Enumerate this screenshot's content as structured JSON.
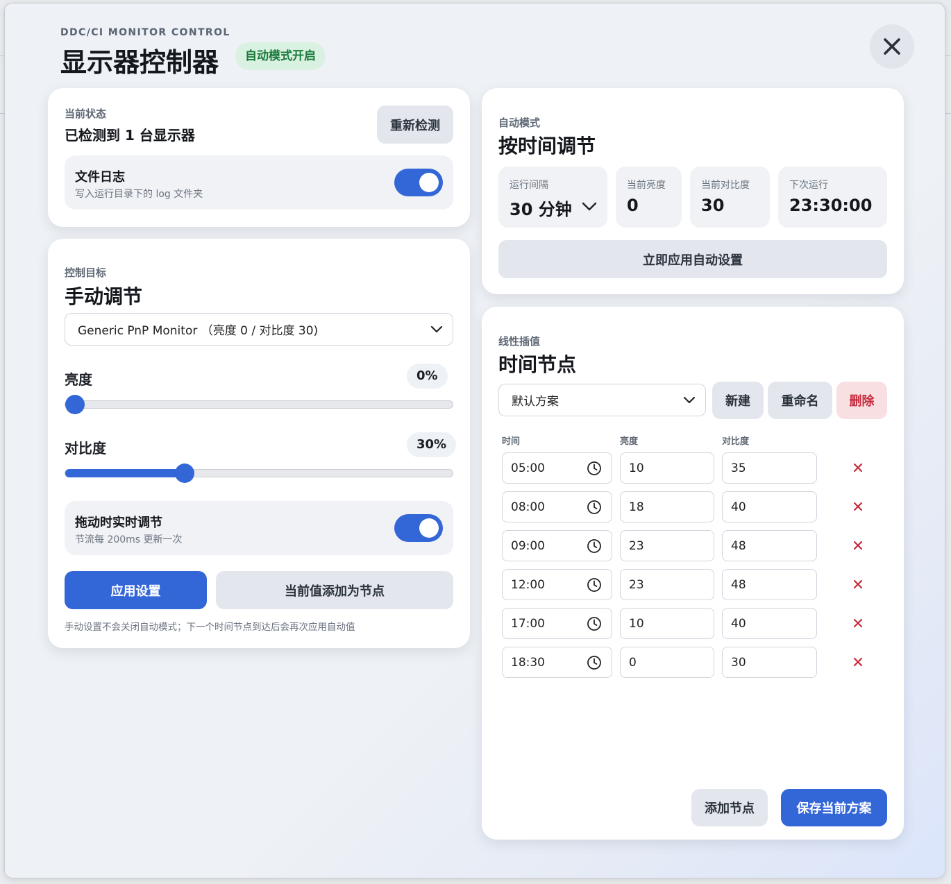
{
  "header": {
    "eyebrow": "DDC/CI MONITOR CONTROL",
    "title": "显示器控制器",
    "auto_badge": "自动模式开启"
  },
  "status": {
    "label": "当前状态",
    "title": "已检测到 1 台显示器",
    "redetect_button": "重新检测",
    "file_log": {
      "title": "文件日志",
      "subtitle": "写入运行目录下的 log 文件夹",
      "enabled": true
    }
  },
  "manual": {
    "label": "控制目标",
    "title": "手动调节",
    "monitor_select": "Generic PnP Monitor （亮度 0 / 对比度 30)",
    "brightness": {
      "label": "亮度",
      "value_text": "0%",
      "value": 0
    },
    "contrast": {
      "label": "对比度",
      "value_text": "30%",
      "value": 30
    },
    "realtime": {
      "title": "拖动时实时调节",
      "subtitle": "节流每 200ms 更新一次",
      "enabled": true
    },
    "apply_button": "应用设置",
    "add_node_button": "当前值添加为节点",
    "note": "手动设置不会关闭自动模式；下一个时间节点到达后会再次应用自动值"
  },
  "auto": {
    "label": "自动模式",
    "title": "按时间调节",
    "stats": [
      {
        "label": "运行间隔",
        "value": "30 分钟"
      },
      {
        "label": "当前亮度",
        "value": "0"
      },
      {
        "label": "当前对比度",
        "value": "30"
      },
      {
        "label": "下次运行",
        "value": "23:30:00"
      }
    ],
    "apply_now_button": "立即应用自动设置"
  },
  "nodes": {
    "label": "线性插值",
    "title": "时间节点",
    "profile_select": "默认方案",
    "new_button": "新建",
    "rename_button": "重命名",
    "delete_button": "删除",
    "columns": [
      "时间",
      "亮度",
      "对比度"
    ],
    "rows": [
      {
        "time": "05:00",
        "brightness": "10",
        "contrast": "35"
      },
      {
        "time": "08:00",
        "brightness": "18",
        "contrast": "40"
      },
      {
        "time": "09:00",
        "brightness": "23",
        "contrast": "48"
      },
      {
        "time": "12:00",
        "brightness": "23",
        "contrast": "48"
      },
      {
        "time": "17:00",
        "brightness": "10",
        "contrast": "40"
      },
      {
        "time": "18:30",
        "brightness": "0",
        "contrast": "30"
      }
    ],
    "add_node_button": "添加节点",
    "save_button": "保存当前方案"
  },
  "colors": {
    "accent": "#3366d6",
    "danger": "#c62a3c",
    "badge_green": "#1a7a3c"
  }
}
